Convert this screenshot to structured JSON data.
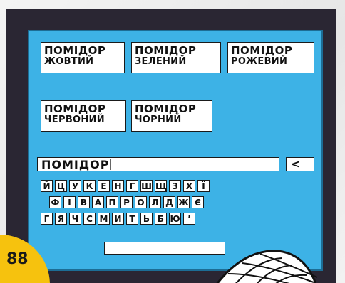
{
  "cards": [
    {
      "line1": "ПОМІДОР",
      "line2": "ЖОВТИЙ"
    },
    {
      "line1": "ПОМІДОР",
      "line2": "ЗЕЛЕНИЙ"
    },
    {
      "line1": "ПОМІДОР",
      "line2": "РОЖЕВИЙ"
    },
    {
      "line1": "ПОМІДОР",
      "line2": "ЧЕРВОНИЙ"
    },
    {
      "line1": "ПОМІДОР",
      "line2": "ЧОРНИЙ"
    }
  ],
  "search": {
    "value": "ПОМІДОР"
  },
  "backspace": {
    "label": "<"
  },
  "keyboard": {
    "row1": [
      "Й",
      "Ц",
      "У",
      "К",
      "Е",
      "Н",
      "Г",
      "Ш",
      "Щ",
      "З",
      "Х",
      "Ї"
    ],
    "row2": [
      "Ф",
      "І",
      "В",
      "А",
      "П",
      "Р",
      "О",
      "Л",
      "Д",
      "Ж",
      "Є"
    ],
    "row3": [
      "Г",
      "Я",
      "Ч",
      "С",
      "М",
      "И",
      "Т",
      "Ь",
      "Б",
      "Ю",
      "’"
    ]
  },
  "page_number": "88",
  "colors": {
    "screen": "#3db2e6",
    "frame": "#2a2633",
    "badge": "#f6c20e"
  }
}
